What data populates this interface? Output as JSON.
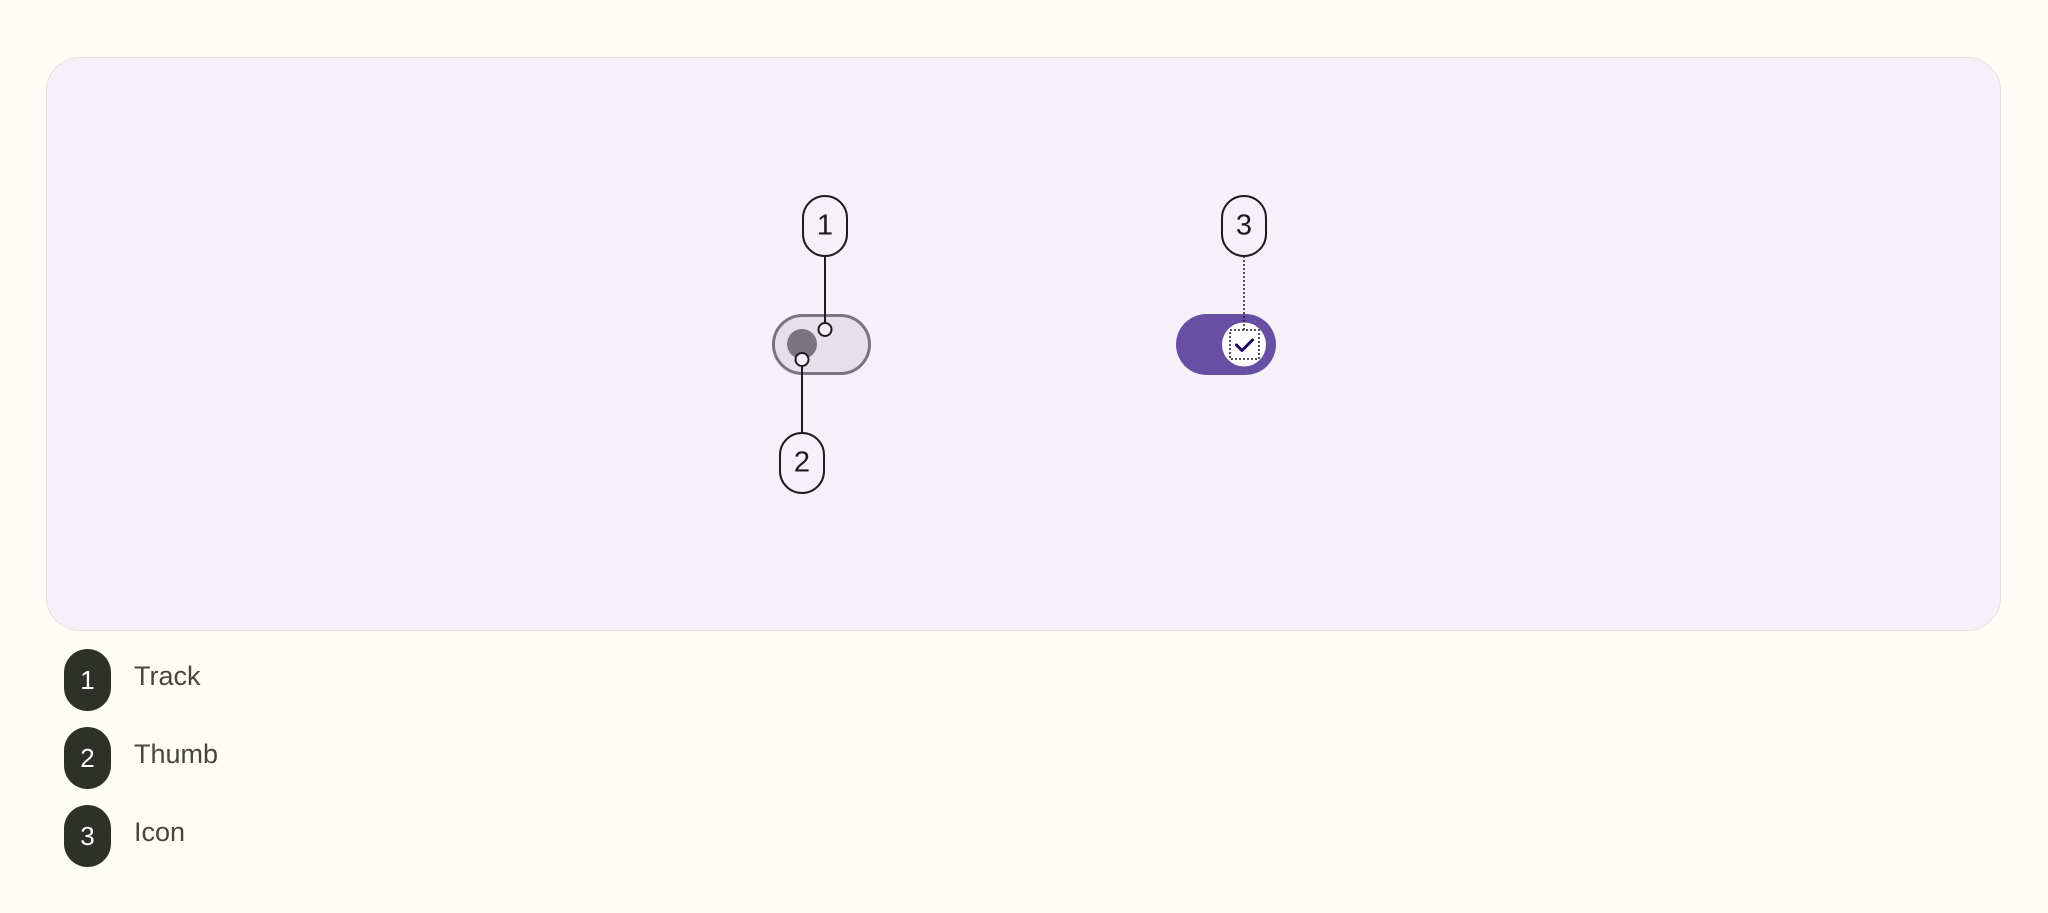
{
  "callouts": [
    {
      "number": "1"
    },
    {
      "number": "2"
    },
    {
      "number": "3"
    }
  ],
  "switches": {
    "off": {
      "selected": false
    },
    "on": {
      "selected": true,
      "icon": "check-icon"
    }
  },
  "legend": [
    {
      "number": "1",
      "label": "Track"
    },
    {
      "number": "2",
      "label": "Thumb"
    },
    {
      "number": "3",
      "label": "Icon"
    }
  ],
  "colors": {
    "page_background": "#FDFDF5",
    "stage_background": "#F6F1F9",
    "track_off": "#E6E0E9",
    "track_off_outline": "#79747E",
    "thumb_off": "#79747E",
    "track_on": "#6750A4",
    "thumb_on": "#FFFFFF",
    "icon_on": "#21005D",
    "badge": "#2E302A"
  }
}
